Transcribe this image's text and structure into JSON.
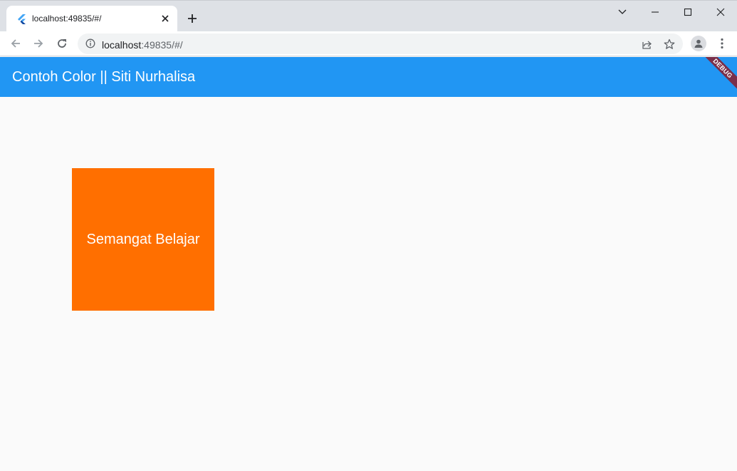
{
  "browser": {
    "tab": {
      "title": "localhost:49835/#/"
    },
    "omnibox": {
      "host": "localhost",
      "rest": ":49835/#/"
    }
  },
  "icons": {
    "favicon": "flutter-icon",
    "tab_close": "close-icon",
    "new_tab": "plus-icon",
    "back": "arrow-left-icon",
    "forward": "arrow-right-icon",
    "reload": "reload-icon",
    "site_info": "info-icon",
    "share": "share-icon",
    "bookmark": "star-icon",
    "profile": "person-icon",
    "menu": "kebab-menu-icon"
  },
  "app": {
    "title": "Contoh Color || Siti Nurhalisa",
    "debug_banner": "DEBUG",
    "box_text": "Semangat Belajar"
  },
  "colors": {
    "appbar": "#2196f3",
    "box": "#ff6f00",
    "background": "#fafafa",
    "debug_banner": "#7a2f4a"
  }
}
